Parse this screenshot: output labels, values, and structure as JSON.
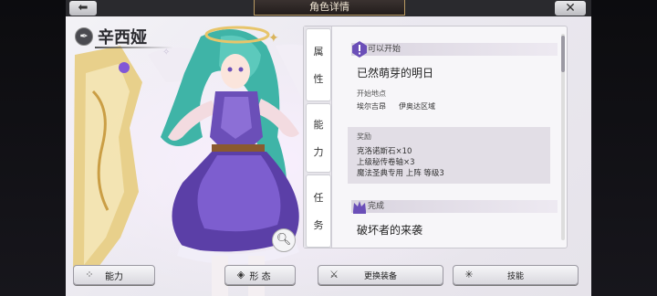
{
  "header": {
    "title": "角色详情",
    "back_icon": "arrow-left-icon",
    "close_icon": "close-icon",
    "back_glyph": "⬅",
    "close_glyph": "✕"
  },
  "character": {
    "name": "辛西娅",
    "name_icon": "quill-icon"
  },
  "tabs": [
    {
      "label_top": "属",
      "label_bottom": "性"
    },
    {
      "label_top": "能",
      "label_bottom": "力"
    },
    {
      "label_top": "任",
      "label_bottom": "务"
    }
  ],
  "quests": [
    {
      "status": "可以开始",
      "status_icon": "exclamation-icon",
      "title": "已然萌芽的明日",
      "start_label": "开始地点",
      "start_place": "埃尔吉昂",
      "start_area": "伊奥达区域",
      "reward_label": "奖励",
      "rewards": [
        "克洛诺斯石×10",
        "上级秘传卷轴×3",
        "魔法圣典专用 上阵 等级3"
      ]
    },
    {
      "status": "完成",
      "status_icon": "crown-icon",
      "title": "破坏者的来袭"
    }
  ],
  "buttons": {
    "ability": "能力",
    "form": "形 态",
    "equip": "更换装备",
    "skill": "技能",
    "ability_icon": "four-dots-icon",
    "form_icon": "diamond-icon",
    "equip_icon": "sword-icon",
    "skill_icon": "sparkle-icon",
    "zoom_icon": "magnifier-icon"
  },
  "colors": {
    "accent_purple": "#6b4fb8",
    "hair_teal": "#3fb4a7",
    "gold": "#d9b45c"
  }
}
